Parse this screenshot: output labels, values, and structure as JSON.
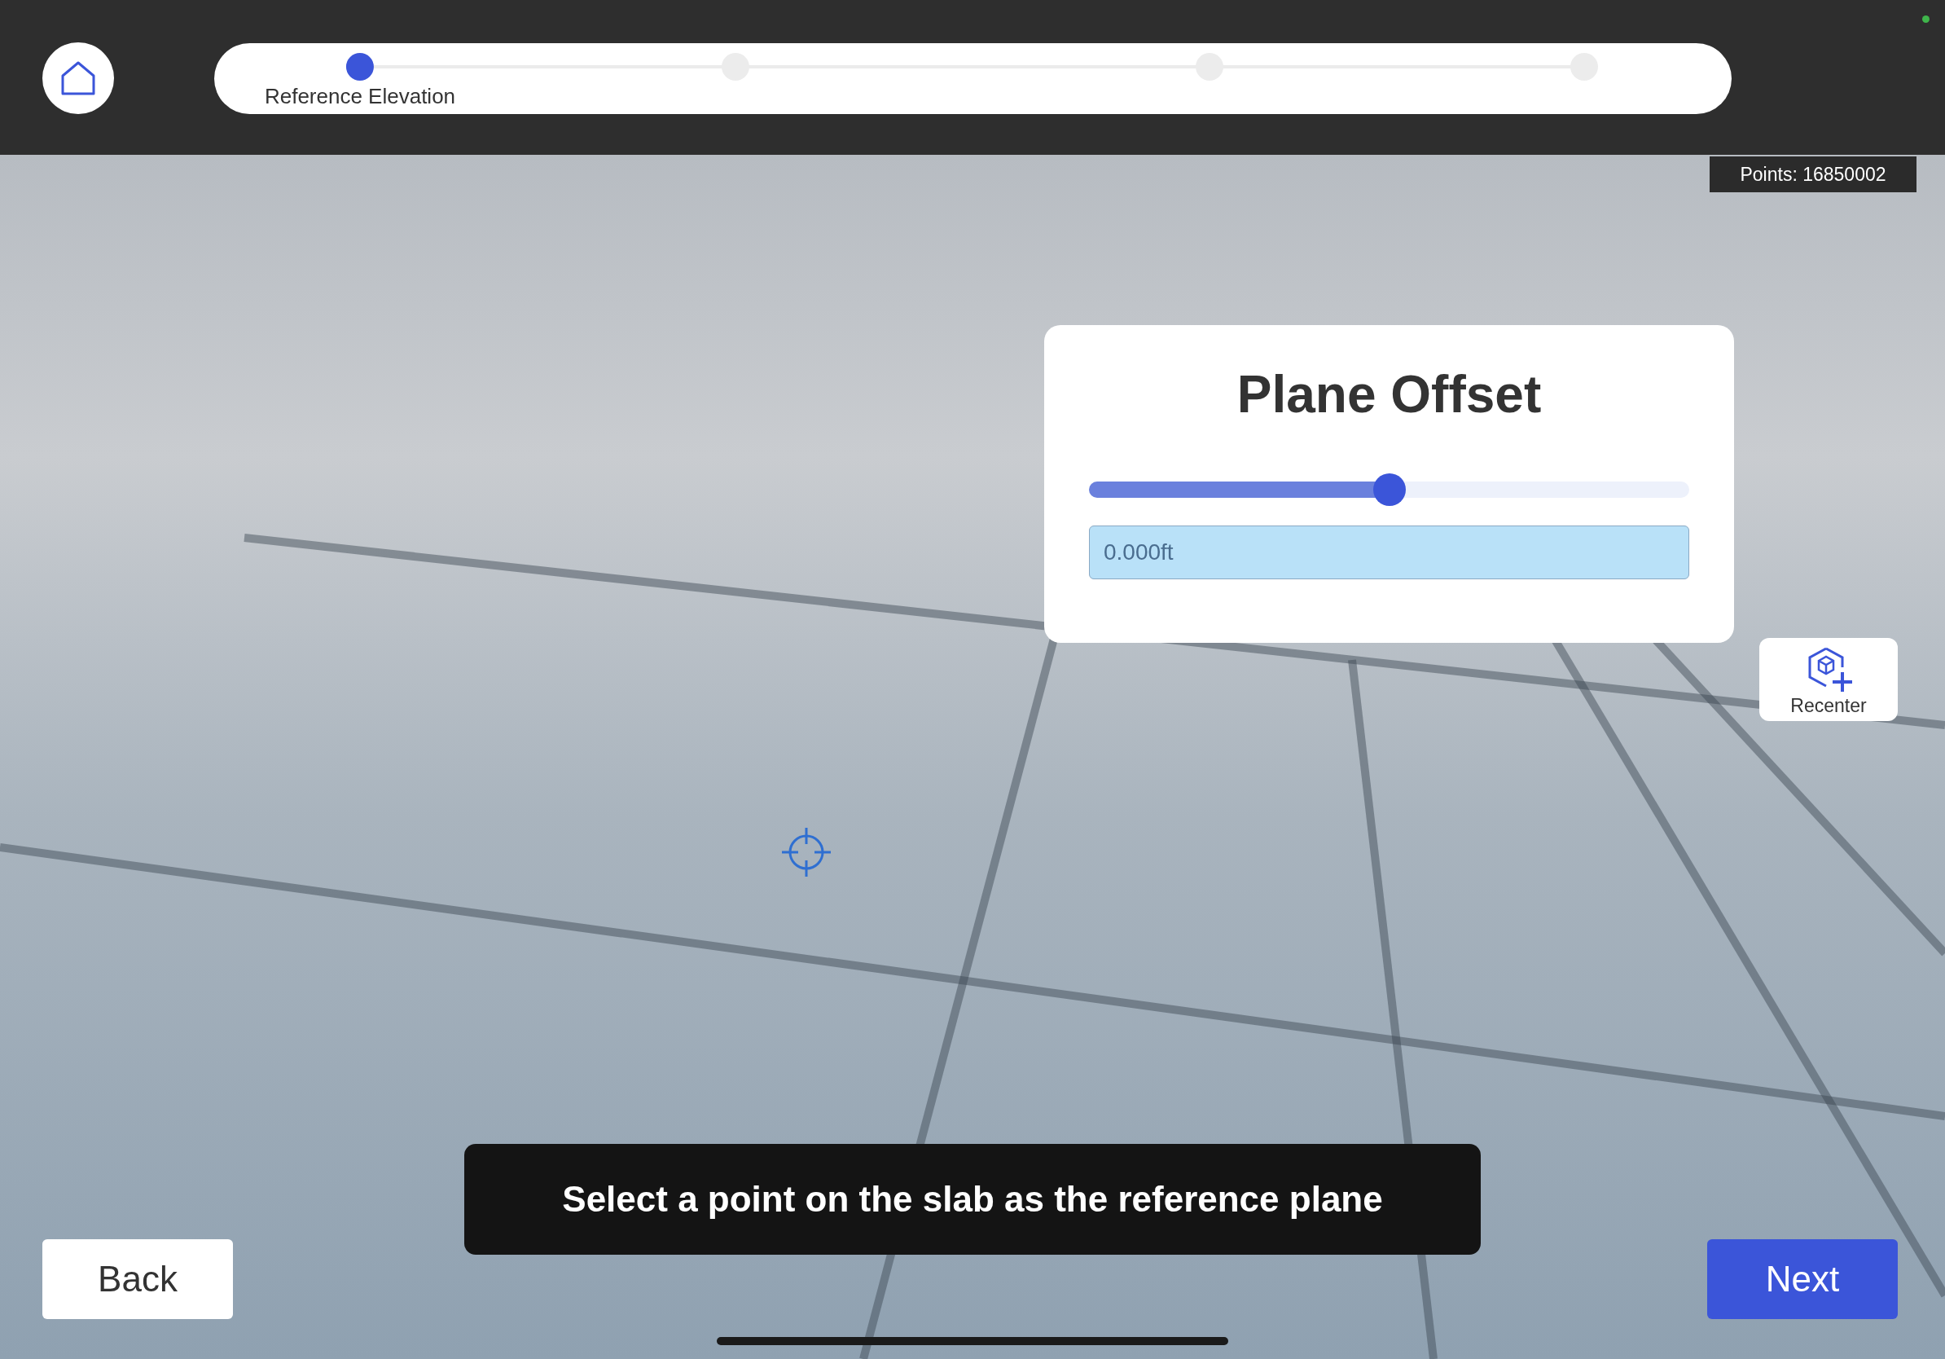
{
  "progress_steps": [
    {
      "label": "Reference Elevation",
      "selected": true
    },
    {
      "selected": false
    },
    {
      "selected": false
    },
    {
      "selected": false
    }
  ],
  "points_count": "Points: 16850002",
  "plane_offset": {
    "title": "Plane Offset",
    "level": 0.5,
    "value": "0.000ft"
  },
  "recenter_button": "Recenter",
  "instruction": "Select a point on the slab as the reference plane",
  "buttons": {
    "back": "Back",
    "next": "Next"
  }
}
